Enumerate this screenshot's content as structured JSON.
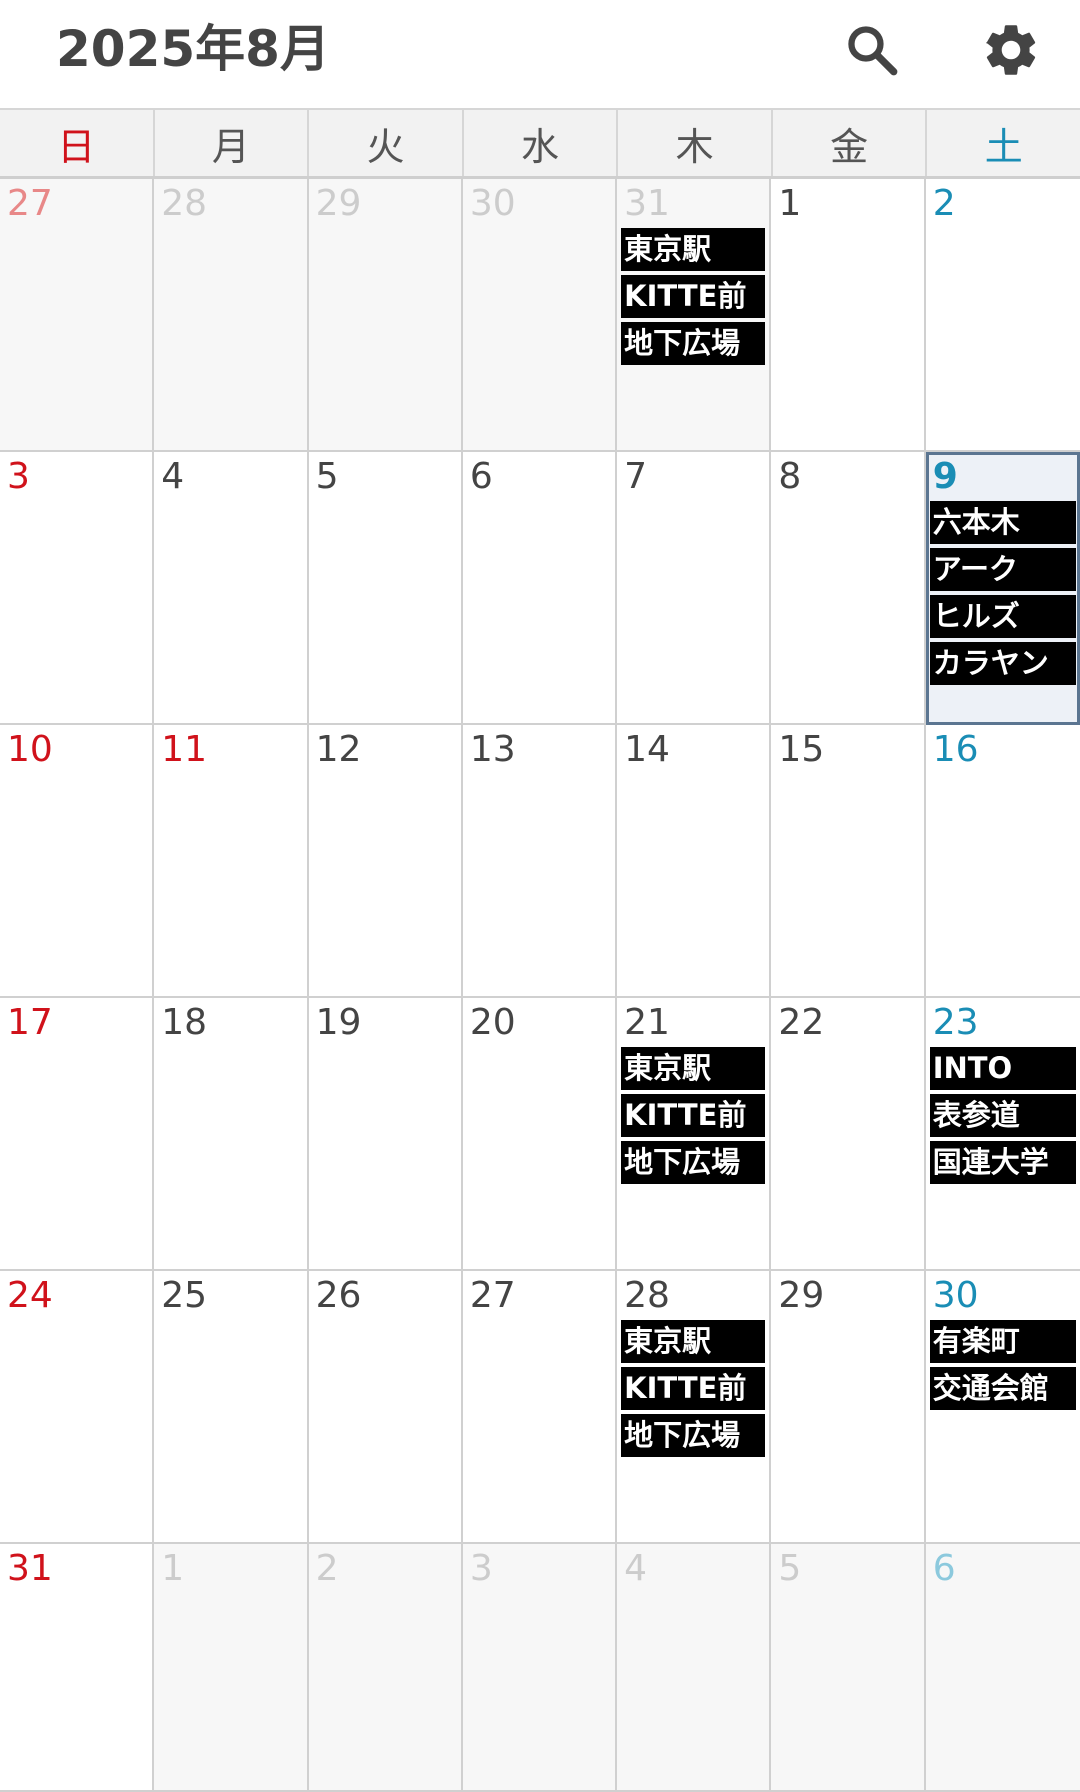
{
  "header": {
    "title": "2025年8月",
    "search_icon": "search-icon",
    "settings_icon": "gear-icon"
  },
  "colors": {
    "sunday": "#d0121b",
    "saturday": "#1a8db5",
    "weekday": "#444444",
    "outside_weekday": "#cccccc",
    "outside_sunday": "#e88888",
    "outside_saturday": "#8cc9dd",
    "event_bg": "#000000",
    "event_text": "#ffffff"
  },
  "weekdays": [
    "日",
    "月",
    "火",
    "水",
    "木",
    "金",
    "土"
  ],
  "weeks": [
    [
      {
        "day": "27",
        "outside": true,
        "events": []
      },
      {
        "day": "28",
        "outside": true,
        "events": []
      },
      {
        "day": "29",
        "outside": true,
        "events": []
      },
      {
        "day": "30",
        "outside": true,
        "events": []
      },
      {
        "day": "31",
        "outside": true,
        "events": [
          "東京駅",
          "KITTE前",
          "地下広場"
        ]
      },
      {
        "day": "1",
        "outside": false,
        "events": []
      },
      {
        "day": "2",
        "outside": false,
        "events": []
      }
    ],
    [
      {
        "day": "3",
        "outside": false,
        "events": []
      },
      {
        "day": "4",
        "outside": false,
        "events": []
      },
      {
        "day": "5",
        "outside": false,
        "events": []
      },
      {
        "day": "6",
        "outside": false,
        "events": []
      },
      {
        "day": "7",
        "outside": false,
        "events": []
      },
      {
        "day": "8",
        "outside": false,
        "events": []
      },
      {
        "day": "9",
        "outside": false,
        "today": true,
        "events": [
          "六本木",
          "アーク",
          "ヒルズ",
          "カラヤン"
        ]
      }
    ],
    [
      {
        "day": "10",
        "outside": false,
        "events": []
      },
      {
        "day": "11",
        "outside": false,
        "holiday": true,
        "events": []
      },
      {
        "day": "12",
        "outside": false,
        "events": []
      },
      {
        "day": "13",
        "outside": false,
        "events": []
      },
      {
        "day": "14",
        "outside": false,
        "events": []
      },
      {
        "day": "15",
        "outside": false,
        "events": []
      },
      {
        "day": "16",
        "outside": false,
        "events": []
      }
    ],
    [
      {
        "day": "17",
        "outside": false,
        "events": []
      },
      {
        "day": "18",
        "outside": false,
        "events": []
      },
      {
        "day": "19",
        "outside": false,
        "events": []
      },
      {
        "day": "20",
        "outside": false,
        "events": []
      },
      {
        "day": "21",
        "outside": false,
        "events": [
          "東京駅",
          "KITTE前",
          "地下広場"
        ]
      },
      {
        "day": "22",
        "outside": false,
        "events": []
      },
      {
        "day": "23",
        "outside": false,
        "events": [
          "INTO",
          "表参道",
          "国連大学"
        ]
      }
    ],
    [
      {
        "day": "24",
        "outside": false,
        "events": []
      },
      {
        "day": "25",
        "outside": false,
        "events": []
      },
      {
        "day": "26",
        "outside": false,
        "events": []
      },
      {
        "day": "27",
        "outside": false,
        "events": []
      },
      {
        "day": "28",
        "outside": false,
        "events": [
          "東京駅",
          "KITTE前",
          "地下広場"
        ]
      },
      {
        "day": "29",
        "outside": false,
        "events": []
      },
      {
        "day": "30",
        "outside": false,
        "events": [
          "有楽町",
          "交通会館"
        ]
      }
    ],
    [
      {
        "day": "31",
        "outside": false,
        "events": []
      },
      {
        "day": "1",
        "outside": true,
        "events": []
      },
      {
        "day": "2",
        "outside": true,
        "events": []
      },
      {
        "day": "3",
        "outside": true,
        "events": []
      },
      {
        "day": "4",
        "outside": true,
        "events": []
      },
      {
        "day": "5",
        "outside": true,
        "events": []
      },
      {
        "day": "6",
        "outside": true,
        "events": []
      }
    ]
  ]
}
